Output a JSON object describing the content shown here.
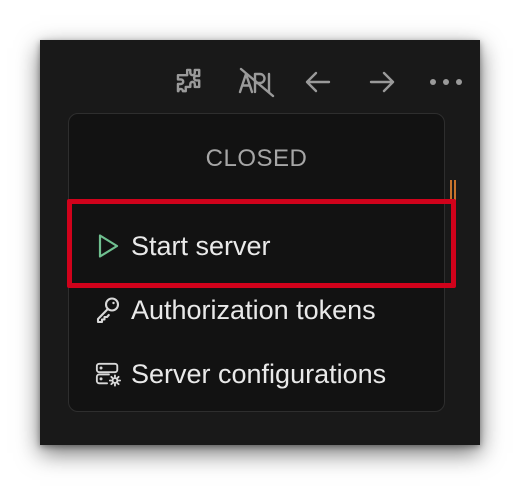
{
  "toolbar": {
    "icons": [
      {
        "name": "extensions-icon"
      },
      {
        "name": "api-off-icon"
      },
      {
        "name": "arrow-left-icon"
      },
      {
        "name": "arrow-right-icon"
      },
      {
        "name": "more-icon"
      }
    ]
  },
  "popup": {
    "status": "CLOSED",
    "items": [
      {
        "label": "Start server",
        "icon": "play-icon",
        "icon_color": "#6fbf8f"
      },
      {
        "label": "Authorization tokens",
        "icon": "key-icon",
        "icon_color": "#d8d8d8"
      },
      {
        "label": "Server configurations",
        "icon": "server-settings-icon",
        "icon_color": "#d8d8d8"
      }
    ]
  },
  "colors": {
    "window_bg": "#191919",
    "popup_bg": "#121212",
    "highlight": "#d0021b"
  }
}
